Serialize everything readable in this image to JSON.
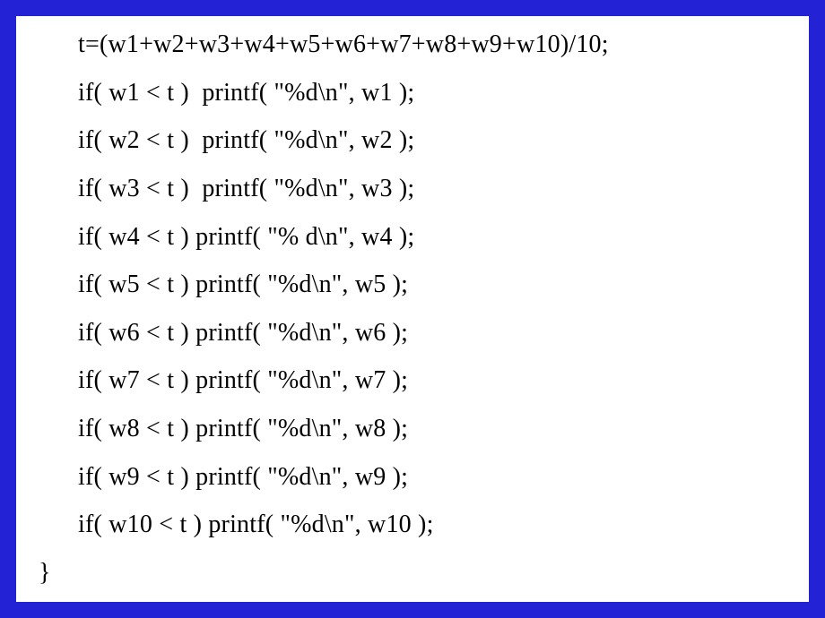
{
  "code": {
    "lines": [
      {
        "text": "t=(w1+w2+w3+w4+w5+w6+w7+w8+w9+w10)/10;",
        "indented": true
      },
      {
        "text": "if( w1 < t )  printf( \"%d\\n\", w1 );",
        "indented": true
      },
      {
        "text": "if( w2 < t )  printf( \"%d\\n\", w2 );",
        "indented": true
      },
      {
        "text": "if( w3 < t )  printf( \"%d\\n\", w3 );",
        "indented": true
      },
      {
        "text": "if( w4 < t ) printf( \"% d\\n\", w4 );",
        "indented": true
      },
      {
        "text": "if( w5 < t ) printf( \"%d\\n\", w5 );",
        "indented": true
      },
      {
        "text": "if( w6 < t ) printf( \"%d\\n\", w6 );",
        "indented": true
      },
      {
        "text": "if( w7 < t ) printf( \"%d\\n\", w7 );",
        "indented": true
      },
      {
        "text": "if( w8 < t ) printf( \"%d\\n\", w8 );",
        "indented": true
      },
      {
        "text": "if( w9 < t ) printf( \"%d\\n\", w9 );",
        "indented": true
      },
      {
        "text": "if( w10 < t ) printf( \"%d\\n\", w10 );",
        "indented": true
      },
      {
        "text": "}",
        "indented": false
      }
    ]
  }
}
